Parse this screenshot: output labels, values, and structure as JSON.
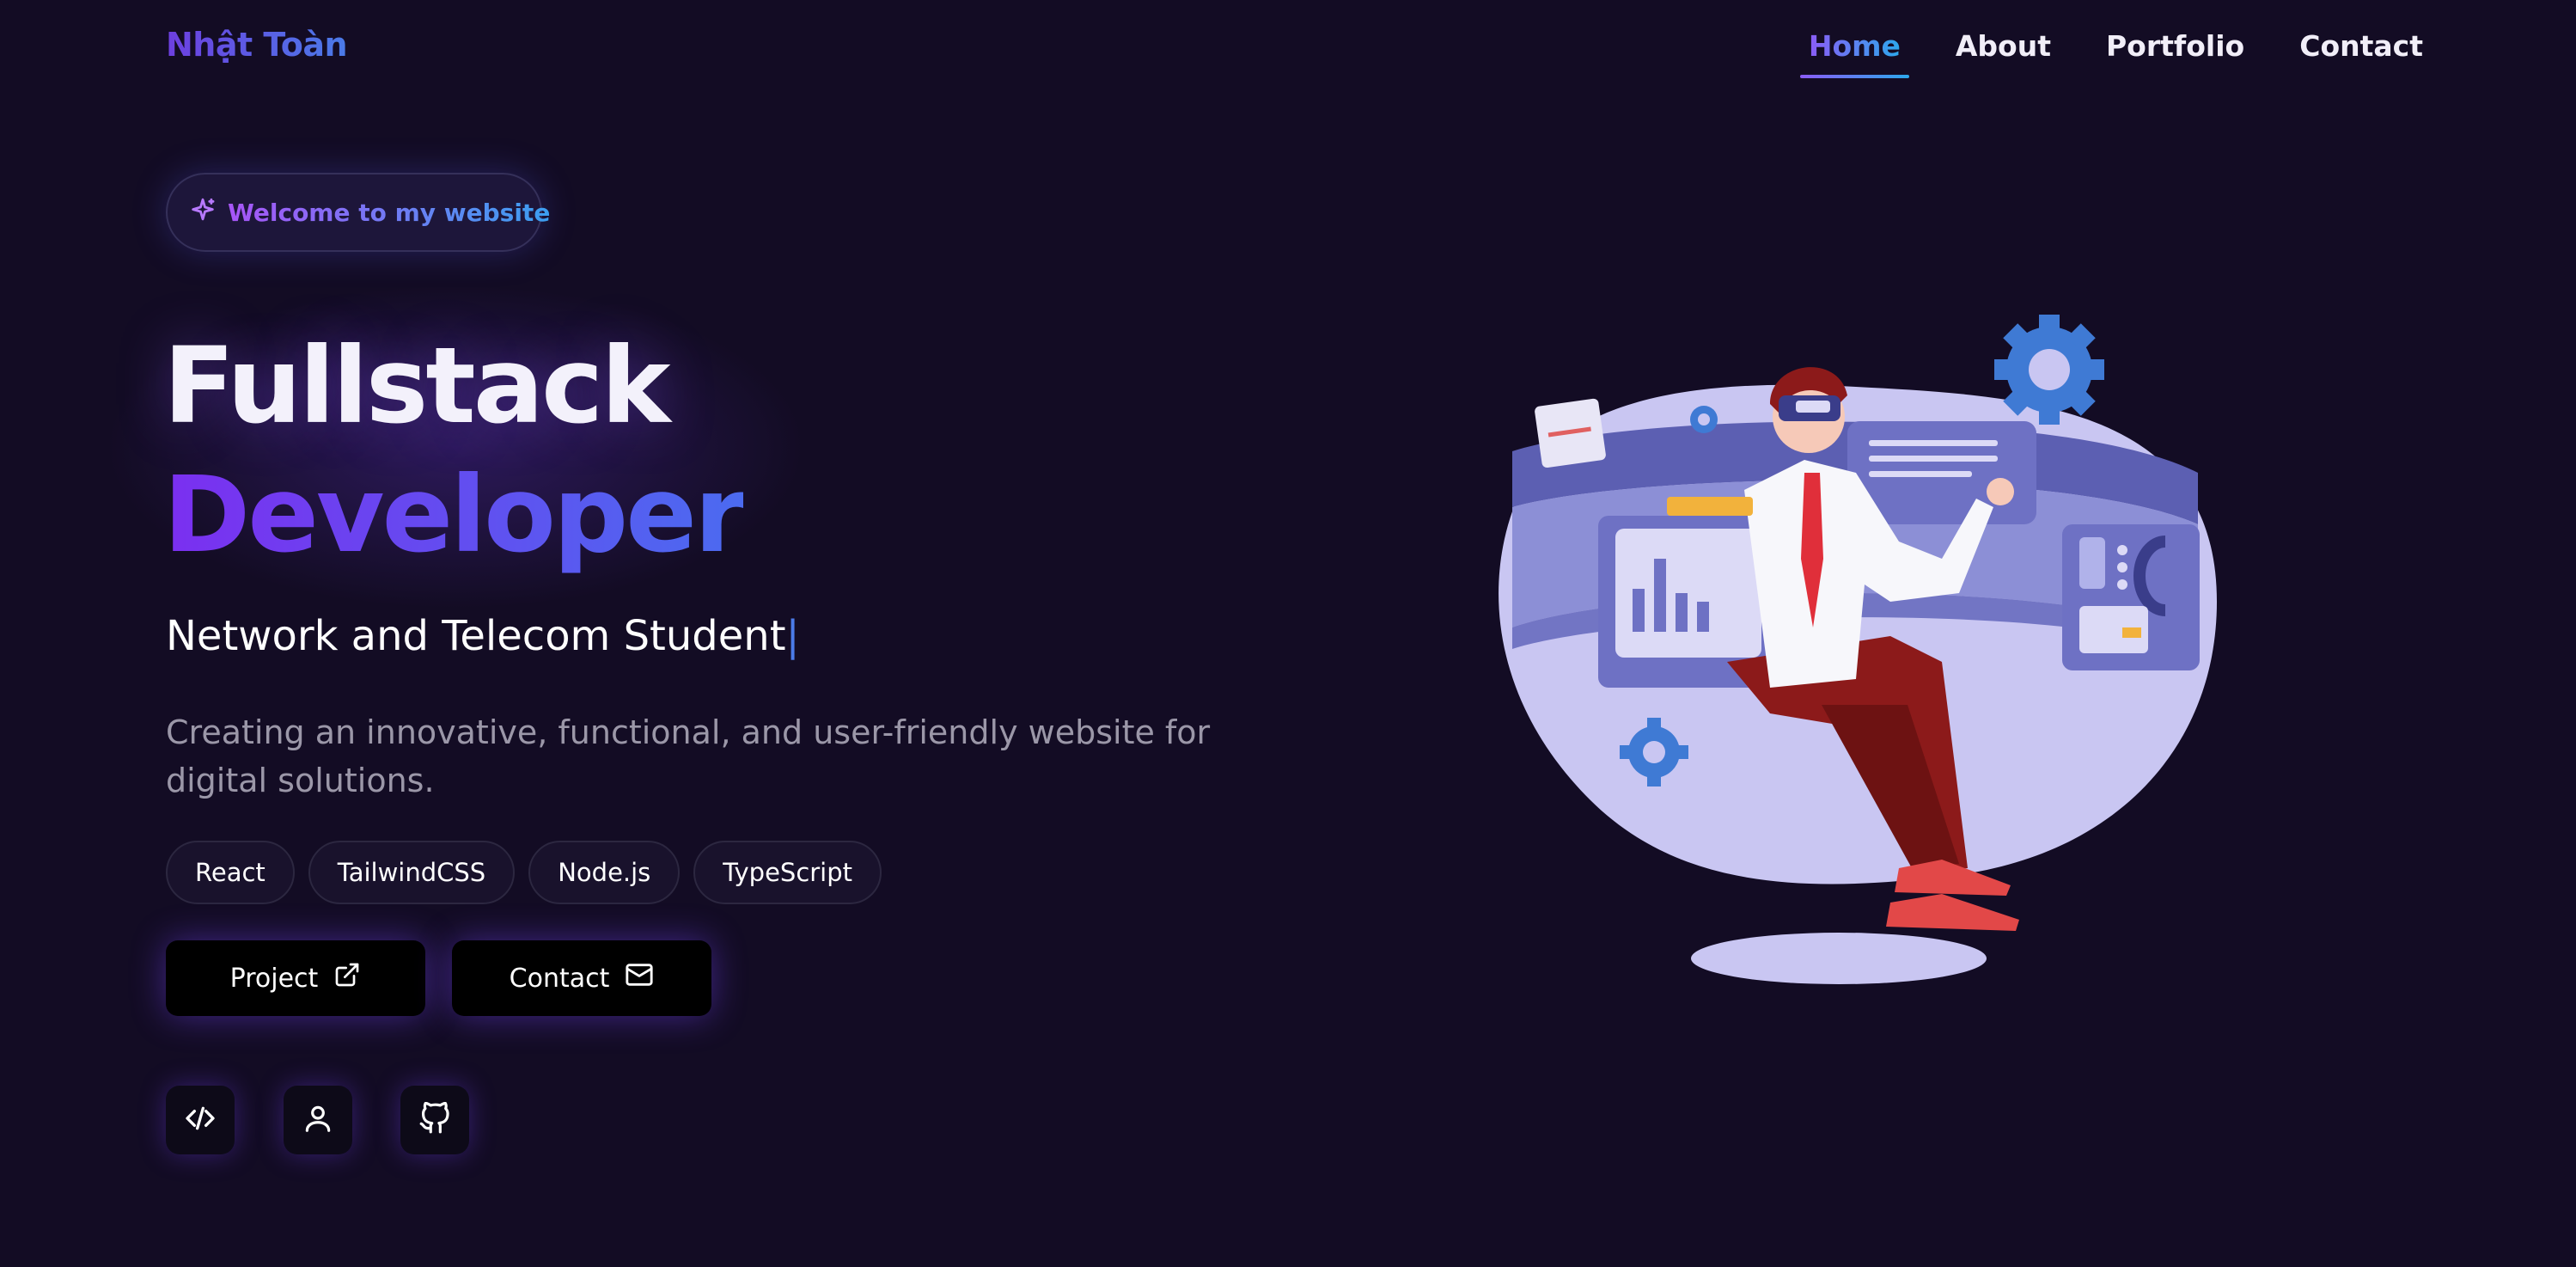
{
  "nav": {
    "logo": "Nhật Toàn",
    "items": [
      {
        "label": "Home",
        "active": true
      },
      {
        "label": "About",
        "active": false
      },
      {
        "label": "Portfolio",
        "active": false
      },
      {
        "label": "Contact",
        "active": false
      }
    ]
  },
  "hero": {
    "badge": "Welcome to my website",
    "title_line1": "Fullstack",
    "title_line2": "Developer",
    "subtitle": "Network and Telecom Student",
    "cursor": "|",
    "description": "Creating an innovative, functional, and user-friendly website for digital solutions.",
    "tags": [
      "React",
      "TailwindCSS",
      "Node.js",
      "TypeScript"
    ],
    "buttons": {
      "project": "Project",
      "contact": "Contact"
    },
    "social_icons": [
      "code-icon",
      "user-icon",
      "github-icon"
    ]
  },
  "colors": {
    "background": "#130c24",
    "accent_purple": "#7b2ff0",
    "accent_blue": "#2ca8ec"
  }
}
